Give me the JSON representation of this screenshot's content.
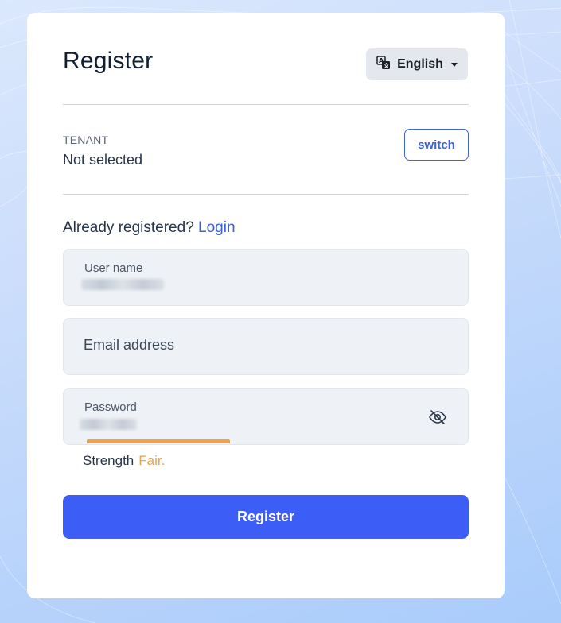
{
  "header": {
    "title": "Register",
    "language_label": "English",
    "language_icon": "translate-icon"
  },
  "tenant": {
    "label": "TENANT",
    "value": "Not selected",
    "switch_label": "switch"
  },
  "login_prompt": {
    "text": "Already registered?",
    "link_label": "Login"
  },
  "form": {
    "username": {
      "label": "User name",
      "value_state": "blurred"
    },
    "email": {
      "placeholder": "Email address"
    },
    "password": {
      "label": "Password",
      "value_state": "blurred",
      "visibility_icon": "eye-off-icon"
    },
    "strength": {
      "label": "Strength",
      "value": "Fair.",
      "level_fraction": 0.35
    },
    "submit_label": "Register"
  },
  "colors": {
    "accent": "#3d5df7",
    "link": "#3a5fdc",
    "strength_fair": "#f0a04b",
    "field_bg": "#eef2f6",
    "lang_button_bg": "#e4e8ee"
  }
}
